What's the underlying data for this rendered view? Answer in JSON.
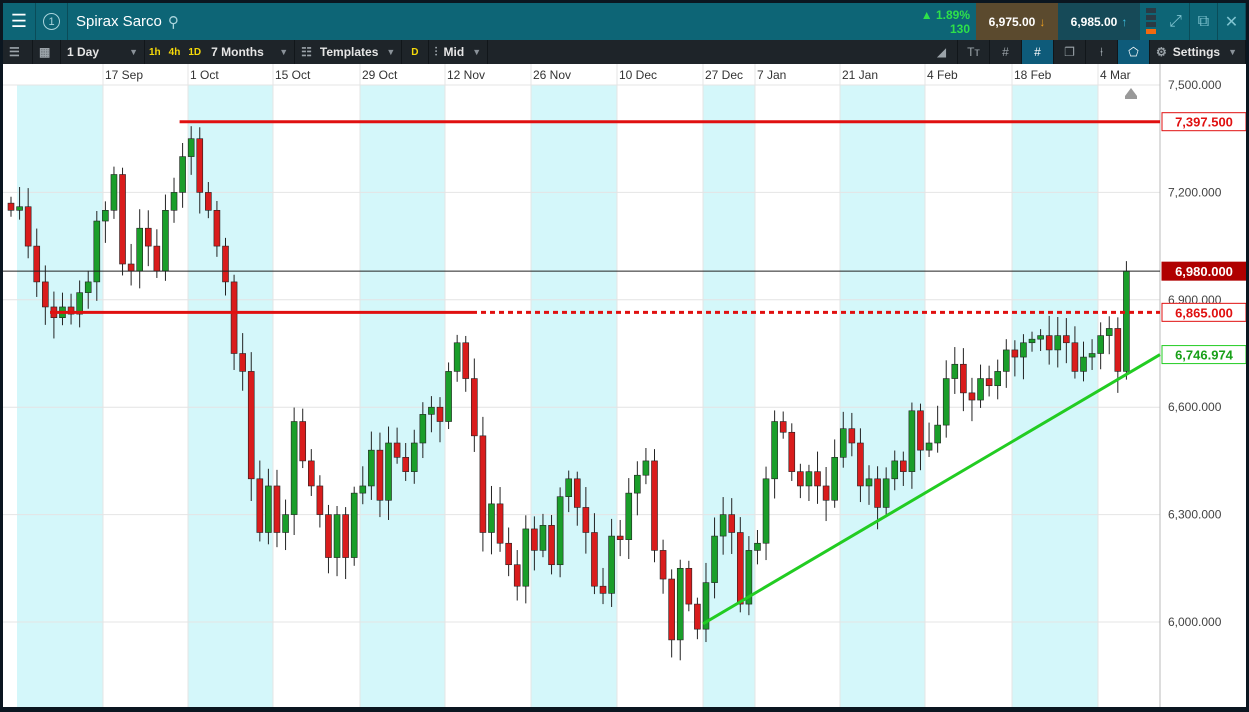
{
  "header": {
    "title": "Spirax Sarco",
    "change_pct": "1.89%",
    "change_pts": "130",
    "sell_price": "6,975.00",
    "buy_price": "6,985.00"
  },
  "toolbar": {
    "interval": "1 Day",
    "quick": [
      "1h",
      "4h",
      "1D"
    ],
    "range": "7 Months",
    "templates": "Templates",
    "d_label": "D",
    "price_type": "Mid",
    "settings": "Settings"
  },
  "x_axis": [
    "17 Sep",
    "1 Oct",
    "15 Oct",
    "29 Oct",
    "12 Nov",
    "26 Nov",
    "10 Dec",
    "27 Dec",
    "7 Jan",
    "21 Jan",
    "4 Feb",
    "18 Feb",
    "4 Mar"
  ],
  "y_axis": [
    "7,500.000",
    "7,200.000",
    "6,900.000",
    "6,600.000",
    "6,300.000",
    "6,000.000"
  ],
  "labels": {
    "resistance": "7,397.500",
    "current": "6,980.000",
    "support": "6,865.000",
    "trend": "6,746.974"
  },
  "colors": {
    "up": "#1a9e2a",
    "down": "#d91c1c",
    "line": "#e01010",
    "trend": "#22cc22"
  },
  "chart_data": {
    "type": "candlestick",
    "ylim": [
      5900,
      7560
    ],
    "closes": [
      7150,
      7160,
      7050,
      6950,
      6880,
      6850,
      6880,
      6860,
      6920,
      6950,
      7120,
      7150,
      7250,
      7000,
      6980,
      7100,
      7050,
      6980,
      7150,
      7200,
      7300,
      7350,
      7200,
      7150,
      7050,
      6950,
      6750,
      6700,
      6400,
      6250,
      6380,
      6250,
      6300,
      6560,
      6450,
      6380,
      6300,
      6180,
      6300,
      6180,
      6360,
      6380,
      6480,
      6340,
      6500,
      6460,
      6420,
      6500,
      6580,
      6600,
      6560,
      6700,
      6780,
      6680,
      6520,
      6250,
      6330,
      6220,
      6160,
      6100,
      6260,
      6200,
      6270,
      6160,
      6350,
      6400,
      6320,
      6250,
      6100,
      6080,
      6240,
      6230,
      6360,
      6410,
      6450,
      6200,
      6120,
      5950,
      6150,
      6050,
      5980,
      6110,
      6240,
      6300,
      6250,
      6050,
      6200,
      6220,
      6400,
      6560,
      6530,
      6420,
      6380,
      6420,
      6380,
      6340,
      6460,
      6540,
      6500,
      6380,
      6400,
      6320,
      6400,
      6450,
      6420,
      6590,
      6480,
      6500,
      6550,
      6680,
      6720,
      6640,
      6620,
      6680,
      6660,
      6700,
      6760,
      6740,
      6780,
      6790,
      6800,
      6760,
      6800,
      6780,
      6700,
      6740,
      6750,
      6800,
      6820,
      6700,
      6980
    ],
    "resistance": 7397.5,
    "current": 6980,
    "support": 6865,
    "trend_start": 5995,
    "trend_end": 6746.974
  }
}
